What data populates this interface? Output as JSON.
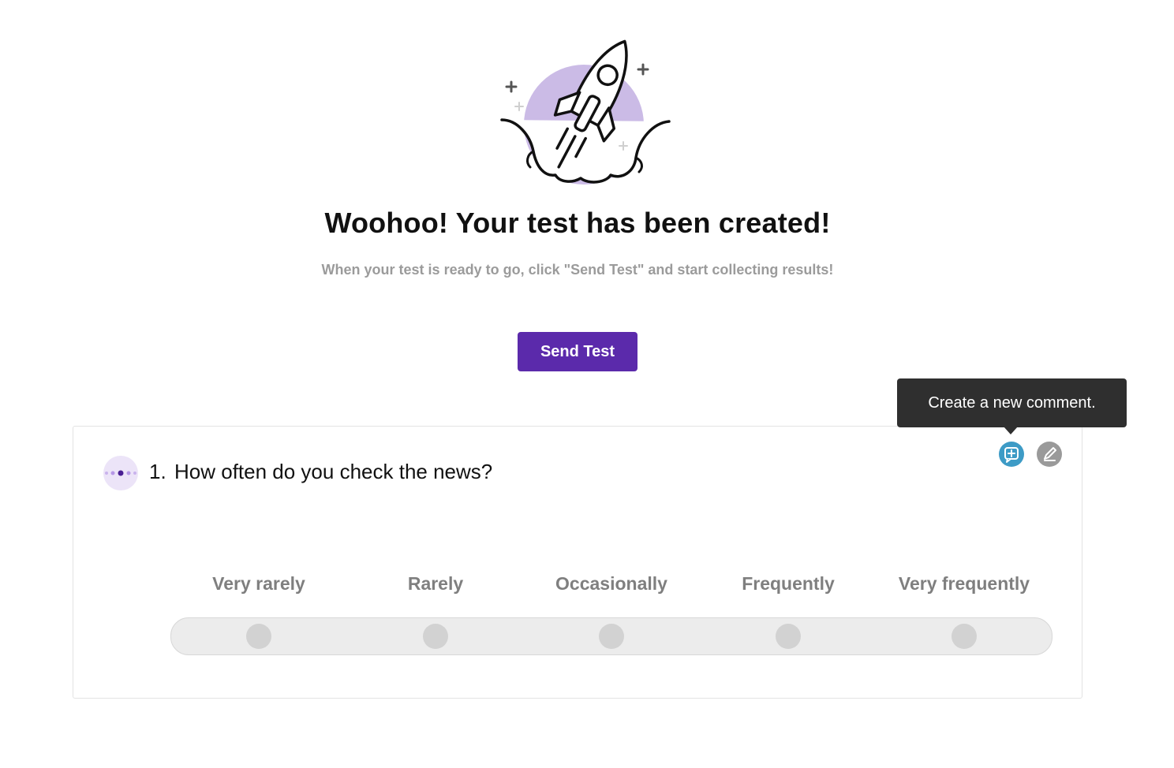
{
  "hero": {
    "title": "Woohoo! Your test has been created!",
    "subtitle": "When your test is ready to go, click \"Send Test\" and start collecting results!",
    "illustration_icon": "rocket-launch-icon",
    "illustration_accent": "#cbbbe6"
  },
  "actions": {
    "send_label": "Send Test",
    "send_color": "#5b2aab"
  },
  "tooltip": {
    "text": "Create a new comment."
  },
  "question": {
    "number": "1.",
    "text": "How often do you check the news?",
    "type_icon": "likert-scale-icon",
    "comment_icon": "add-comment-icon",
    "edit_icon": "edit-pen-icon",
    "comment_color": "#3d9bc6",
    "edit_color": "#9a9a9a",
    "scale": {
      "options": [
        "Very rarely",
        "Rarely",
        "Occasionally",
        "Frequently",
        "Very frequently"
      ]
    }
  }
}
